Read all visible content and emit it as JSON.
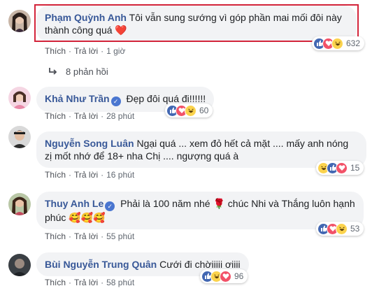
{
  "comments": [
    {
      "name": "Phạm Quỳnh Anh",
      "text": "Tôi vẫn sung sướng vì góp phần mai mối đôi này thành công quá",
      "heart": "❤️",
      "like_label": "Thích",
      "reply_label": "Trả lời",
      "time": "1 giờ",
      "reaction_count": "632",
      "reactions": [
        "like",
        "love",
        "haha"
      ]
    },
    {
      "name": "Khả Như Trần",
      "verified": true,
      "text": "Đẹp đôi quá đi!!!!!!",
      "like_label": "Thích",
      "reply_label": "Trả lời",
      "time": "28 phút",
      "reaction_count": "60",
      "reactions": [
        "like",
        "love",
        "haha"
      ]
    },
    {
      "name": "Nguyễn Song Luân",
      "text": "Ngại quá ... xem đỏ hết cả mặt .... mấy anh nóng zị mốt nhớ để 18+ nha Chị .... ngượng quá à",
      "like_label": "Thích",
      "reply_label": "Trả lời",
      "time": "16 phút",
      "reaction_count": "15",
      "reactions": [
        "haha",
        "like",
        "love"
      ]
    },
    {
      "name": "Thuy Anh Le",
      "verified": true,
      "text": "Phải là 100 năm nhé 🌹 chúc Nhi và Thắng luôn hạnh phúc 🥰🥰🥰",
      "like_label": "Thích",
      "reply_label": "Trả lời",
      "time": "55 phút",
      "reaction_count": "53",
      "reactions": [
        "like",
        "love",
        "haha"
      ]
    },
    {
      "name": "Bùi Nguyễn Trung Quân",
      "text": "Cưới đi chờiiiii ơiiii",
      "like_label": "Thích",
      "reply_label": "Trả lời",
      "time": "58 phút",
      "reaction_count": "96",
      "reactions": [
        "like",
        "haha",
        "love"
      ]
    }
  ],
  "replies_label": "8 phản hồi",
  "separator": "·",
  "colors": {
    "name": "#385898",
    "bubble": "#f2f3f5",
    "highlight": "#d3243a",
    "like": "#4267b2",
    "love": "#f25268",
    "haha": "#fbd34d"
  },
  "icons": {
    "replies": "reply-arrow-icon",
    "verified": "verified-check-icon",
    "reactions": [
      "like-reaction-icon",
      "love-reaction-icon",
      "haha-reaction-icon"
    ]
  }
}
